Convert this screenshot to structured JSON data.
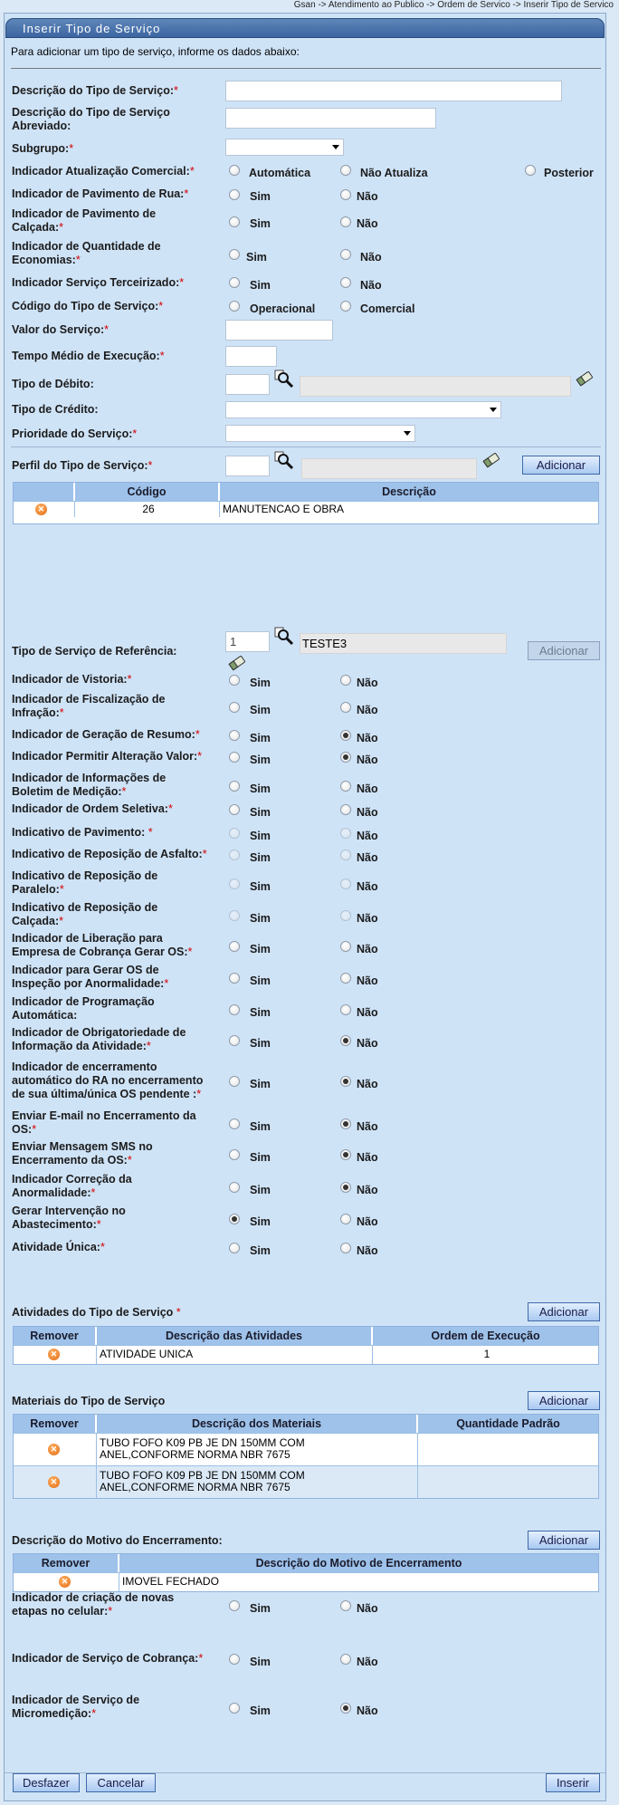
{
  "breadcrumb": "Gsan -> Atendimento ao Publico -> Ordem de Servico -> Inserir Tipo de Servico",
  "title": "Inserir Tipo de Serviço",
  "intro": "Para adicionar um tipo de serviço, informe os dados abaixo:",
  "req": "*",
  "labels": {
    "descricao": "Descrição do Tipo de Serviço:",
    "abrev1": "Descrição do Tipo de Serviço",
    "abrev2": "Abreviado:",
    "subgrupo": "Subgrupo:",
    "atualizacao": "Indicador Atualização Comercial:",
    "pav_rua": "Indicador de Pavimento de Rua:",
    "pav_calc1": "Indicador de Pavimento de",
    "pav_calc2": "Calçada:",
    "qtd_eco1": "Indicador de Quantidade de",
    "qtd_eco2": "Economias:",
    "terceirizado": "Indicador Serviço Terceirizado:",
    "codigo": "Código do Tipo de Serviço:",
    "valor": "Valor do Serviço:",
    "tempo": "Tempo Médio de Execução:",
    "tipo_debito": "Tipo de Débito:",
    "tipo_credito": "Tipo de Crédito:",
    "prioridade": "Prioridade do Serviço:",
    "perfil": "Perfil do Tipo de Serviço:",
    "referencia": "Tipo de Serviço de Referência:"
  },
  "opts": {
    "automatica": "Automática",
    "nao_atualiza": "Não Atualiza",
    "posterior": "Posterior",
    "sim": "Sim",
    "nao": "Não",
    "operacional": "Operacional",
    "comercial": "Comercial"
  },
  "buttons": {
    "adicionar": "Adicionar",
    "desfazer": "Desfazer",
    "cancelar": "Cancelar",
    "inserir": "Inserir"
  },
  "perfil_table": {
    "headers": [
      "Código",
      "Descrição"
    ],
    "rows": [
      {
        "codigo": "26",
        "descricao": "MANUTENCAO E OBRA"
      }
    ]
  },
  "referencia": {
    "codigo": "1",
    "nome": "TESTE3"
  },
  "indicadores": [
    {
      "l1": "Indicador de Vistoria:",
      "l2": "",
      "sel": "none",
      "dis": false
    },
    {
      "l1": "Indicador de Fiscalização de",
      "l2": "Infração:",
      "sel": "none",
      "dis": false
    },
    {
      "l1": "Indicador de Geração de Resumo:",
      "l2": "",
      "sel": "nao",
      "dis": false
    },
    {
      "l1": "Indicador Permitir Alteração Valor:",
      "l2": "",
      "sel": "nao",
      "dis": false
    },
    {
      "l1": "Indicador de Informações de",
      "l2": "Boletim de Medição:",
      "sel": "none",
      "dis": false
    },
    {
      "l1": "Indicador de Ordem Seletiva:",
      "l2": "",
      "sel": "none",
      "dis": false
    },
    {
      "l1": "Indicativo de Pavimento: ",
      "l2": "",
      "sel": "none",
      "dis": true
    },
    {
      "l1": "Indicativo de Reposição de Asfalto:",
      "l2": "",
      "sel": "none",
      "dis": true
    },
    {
      "l1": "Indicativo de Reposição de",
      "l2": "Paralelo:",
      "sel": "none",
      "dis": true
    },
    {
      "l1": "Indicativo de Reposição de",
      "l2": "Calçada:",
      "sel": "none",
      "dis": true
    },
    {
      "l1": "Indicador de Liberação para",
      "l2": "Empresa de Cobrança Gerar OS:",
      "sel": "none",
      "dis": false
    },
    {
      "l1": "Indicador para Gerar OS de",
      "l2": "Inspeção por Anormalidade:",
      "sel": "none",
      "dis": false
    },
    {
      "l1": "Indicador de Programação",
      "l2": "Automática:",
      "sel": "none",
      "dis": false,
      "noreq": true
    },
    {
      "l1": "Indicador de Obrigatoriedade de",
      "l2": "Informação da Atividade:",
      "sel": "nao",
      "dis": false
    },
    {
      "l1": "Indicador de encerramento",
      "l2": "automático do RA no encerramento",
      "l3": "de sua última/única OS pendente :",
      "sel": "nao",
      "dis": false
    },
    {
      "l1": "Enviar E-mail no Encerramento da",
      "l2": "OS:",
      "sel": "nao",
      "dis": false
    },
    {
      "l1": "Enviar Mensagem SMS no",
      "l2": "Encerramento da OS:",
      "sel": "nao",
      "dis": false
    },
    {
      "l1": "Indicador Correção da",
      "l2": "Anormalidade:",
      "sel": "nao",
      "dis": false
    },
    {
      "l1": "Gerar Intervenção no",
      "l2": "Abastecimento:",
      "sel": "sim",
      "dis": false
    },
    {
      "l1": "Atividade Única:",
      "l2": "",
      "sel": "none",
      "dis": false
    }
  ],
  "atividades": {
    "title": "Atividades do Tipo de Serviço ",
    "headers": [
      "Remover",
      "Descrição das Atividades",
      "Ordem de Execução"
    ],
    "rows": [
      {
        "descricao": "ATIVIDADE UNICA",
        "ordem": "1"
      }
    ]
  },
  "materiais": {
    "title": "Materiais do Tipo de Serviço",
    "headers": [
      "Remover",
      "Descrição dos Materiais",
      "Quantidade Padrão"
    ],
    "rows": [
      {
        "l1": "TUBO FOFO K09 PB JE DN 150MM COM",
        "l2": "ANEL,CONFORME NORMA NBR 7675"
      },
      {
        "l1": "TUBO FOFO K09 PB JE DN 150MM COM",
        "l2": "ANEL,CONFORME NORMA NBR 7675"
      }
    ]
  },
  "motivo": {
    "title": "Descrição do Motivo do Encerramento:",
    "headers": [
      "Remover",
      "Descrição do Motivo de Encerramento"
    ],
    "rows": [
      {
        "descricao": "IMOVEL FECHADO"
      }
    ]
  },
  "finais": [
    {
      "l1": "Indicador de criação de novas",
      "l2": "etapas no celular:",
      "sel": "none"
    },
    {
      "l1": "Indicador de Serviço de Cobrança:",
      "l2": "",
      "sel": "none"
    },
    {
      "l1": "Indicador de Serviço de",
      "l2": "Micromedição:",
      "sel": "nao"
    }
  ],
  "icons": {
    "search": "search-icon",
    "eraser": "eraser-icon",
    "remove": "remove-icon"
  }
}
